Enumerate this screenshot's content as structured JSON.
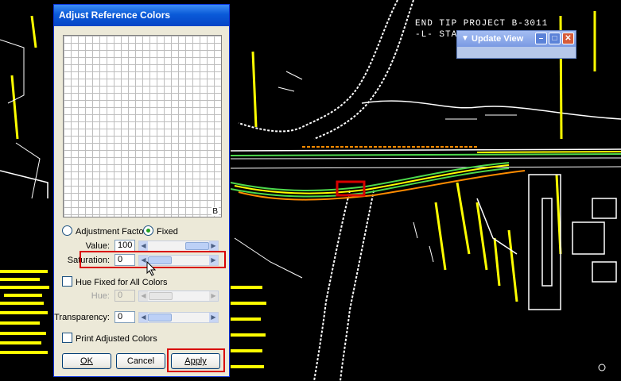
{
  "background": {
    "cad_labels": {
      "project": "END TIP PROJECT B-3011",
      "station": "-L- STA"
    }
  },
  "dialog": {
    "title": "Adjust Reference Colors",
    "grid_corner_label": "B",
    "mode": {
      "adjustment_factor_label": "Adjustment Factor",
      "fixed_label": "Fixed",
      "selected": "Fixed"
    },
    "value": {
      "label": "Value:",
      "value": "100",
      "slider_fraction": 1.0
    },
    "saturation": {
      "label": "Saturation:",
      "value": "0",
      "slider_fraction": 0.0
    },
    "hue_fixed_checkbox": {
      "label": "Hue Fixed for All Colors",
      "checked": false
    },
    "hue": {
      "label": "Hue:",
      "value": "0",
      "enabled": false
    },
    "transparency": {
      "label": "Transparency:",
      "value": "0",
      "slider_fraction": 0.0
    },
    "print_adjusted_checkbox": {
      "label": "Print Adjusted Colors",
      "checked": false
    },
    "buttons": {
      "ok": "OK",
      "cancel": "Cancel",
      "apply": "Apply"
    },
    "highlight_color": "#d80000"
  },
  "update_view": {
    "title": "Update View",
    "controls": [
      "minimize-icon",
      "maximize-icon",
      "close-icon"
    ]
  },
  "colors": {
    "cad_background": "#000000",
    "cad_yellow": "#ffff00",
    "cad_orange": "#ff8c00",
    "cad_green": "#4cd84c",
    "xp_blue": "#0a5ad8",
    "dialog_face": "#ece9d8"
  }
}
